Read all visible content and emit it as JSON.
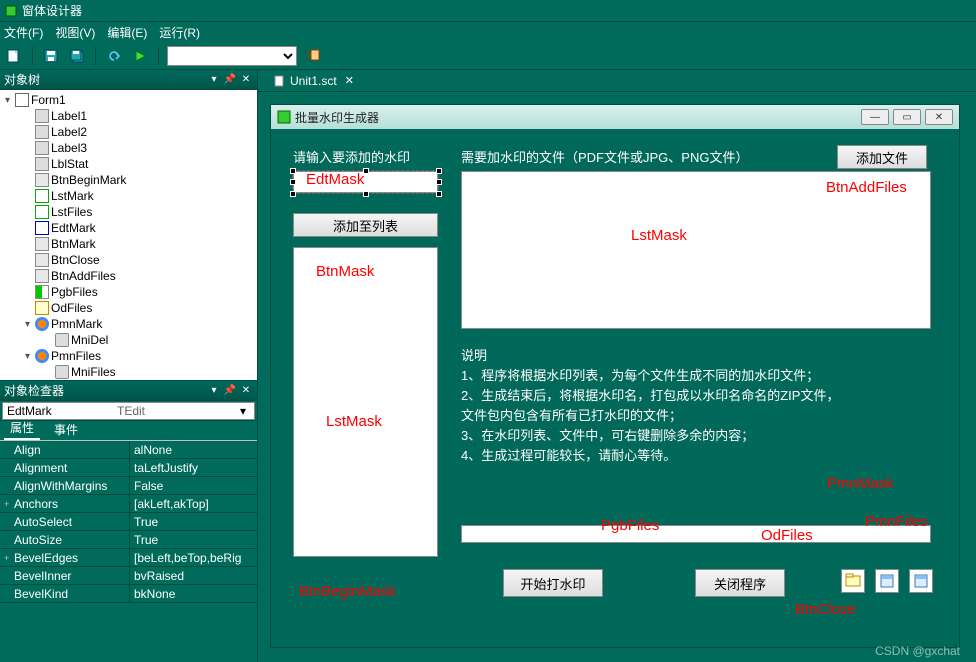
{
  "app": {
    "title": "窗体设计器"
  },
  "menu": {
    "file": "文件(F)",
    "view": "视图(V)",
    "edit": "编辑(E)",
    "run": "运行(R)"
  },
  "panels": {
    "tree_title": "对象树",
    "inspector_title": "对象检查器"
  },
  "tree": {
    "root": "Form1",
    "items": [
      "Label1",
      "Label2",
      "Label3",
      "LblStat",
      "BtnBeginMark",
      "LstMark",
      "LstFiles",
      "EdtMark",
      "BtnMark",
      "BtnClose",
      "BtnAddFiles",
      "PgbFiles",
      "OdFiles"
    ],
    "pmn1": "PmnMark",
    "pmn1_item": "MniDel",
    "pmn2": "PmnFiles",
    "pmn2_item": "MniFiles"
  },
  "inspector": {
    "selected_name": "EdtMark",
    "selected_type": "TEdit",
    "tab_attr": "属性",
    "tab_event": "事件",
    "rows": [
      {
        "k": "Align",
        "v": "alNone",
        "exp": ""
      },
      {
        "k": "Alignment",
        "v": "taLeftJustify",
        "exp": ""
      },
      {
        "k": "AlignWithMargins",
        "v": "False",
        "exp": ""
      },
      {
        "k": "Anchors",
        "v": "[akLeft,akTop]",
        "exp": "+"
      },
      {
        "k": "AutoSelect",
        "v": "True",
        "exp": ""
      },
      {
        "k": "AutoSize",
        "v": "True",
        "exp": ""
      },
      {
        "k": "BevelEdges",
        "v": "[beLeft,beTop,beRig",
        "exp": "+"
      },
      {
        "k": "BevelInner",
        "v": "bvRaised",
        "exp": ""
      },
      {
        "k": "BevelKind",
        "v": "bkNone",
        "exp": ""
      }
    ]
  },
  "tabstrip": {
    "tab1": "Unit1.sct"
  },
  "form": {
    "title": "批量水印生成器",
    "lbl_input": "请输入要添加的水印",
    "lbl_files": "需要加水印的文件（PDF文件或JPG、PNG文件）",
    "btn_add_to_list": "添加至列表",
    "btn_add_files": "添加文件",
    "btn_begin": "开始打水印",
    "btn_close": "关闭程序",
    "desc_title": "说明",
    "desc_1": "1、程序将根据水印列表，为每个文件生成不同的加水印文件；",
    "desc_2": "2、生成结束后，将根据水印名，打包成以水印名命名的ZIP文件，",
    "desc_2b": "文件包内包含有所有已打水印的文件；",
    "desc_3": "3、在水印列表、文件中，可右键删除多余的内容；",
    "desc_4": "4、生成过程可能较长，请耐心等待。"
  },
  "annotations": {
    "edtmask": "EdtMask",
    "btnmask": "BtnMask",
    "lstmask": "LstMask",
    "btnbegin": "BtnBeginMask",
    "btnaddfiles": "BtnAddFiles",
    "lstmask2": "LstMask",
    "pgbfiles": "PgbFiles",
    "odfiles": "OdFiles",
    "pmnmask": "PmnMask",
    "pmnfiles": "PmnFiles",
    "btnclose": "BtnClose"
  },
  "watermark": "CSDN @gxchat"
}
